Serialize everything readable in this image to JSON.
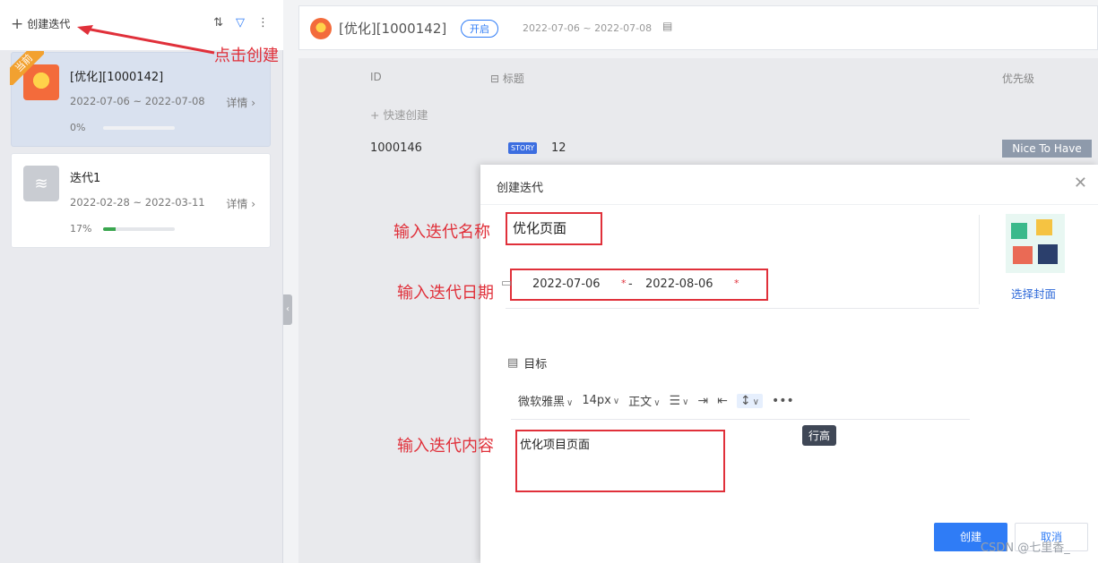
{
  "sidebar": {
    "create_label": "创建迭代",
    "tools": {
      "sort_icon": "⇅",
      "filter_icon": "▽",
      "more_icon": "⋮"
    },
    "cards": [
      {
        "name": "[优化][1000142]",
        "dates": "2022-07-06 ~ 2022-07-08",
        "detail": "详情",
        "progress": "0%",
        "progress_value": 0,
        "badge": "当前"
      },
      {
        "name": "迭代1",
        "dates": "2022-02-28 ~ 2022-03-11",
        "detail": "详情",
        "progress": "17%",
        "progress_value": 17
      }
    ]
  },
  "header": {
    "title": "[优化][1000142]",
    "status": "开启",
    "dates": "2022-07-06 ~ 2022-07-08"
  },
  "table": {
    "columns": {
      "id": "ID",
      "title": "标题",
      "priority": "优先级"
    },
    "quick_create": "快速创建",
    "rows": [
      {
        "id": "1000146",
        "type": "STORY",
        "title": "12",
        "priority": "Nice To Have"
      }
    ]
  },
  "dialog": {
    "title": "创建迭代",
    "name_value": "优化页面",
    "start_date": "2022-07-06",
    "end_date": "2022-08-06",
    "date_separator": "-",
    "required_mark": "*",
    "cover_label": "选择封面",
    "goal_label": "目标",
    "toolbar": {
      "font": "微软雅黑",
      "size": "14px",
      "style": "正文"
    },
    "tooltip": "行高",
    "content": "优化项目页面",
    "create_button": "创建",
    "cancel_button": "取消"
  },
  "annotations": {
    "click_create": "点击创建",
    "input_name": "输入迭代名称",
    "input_date": "输入迭代日期",
    "input_content": "输入迭代内容"
  },
  "watermark": "CSDN @七里香_",
  "colors": {
    "accent": "#2f7cf6",
    "annotation": "#e0303a",
    "progress": "#3aa64f",
    "badge": "#f2a130"
  }
}
